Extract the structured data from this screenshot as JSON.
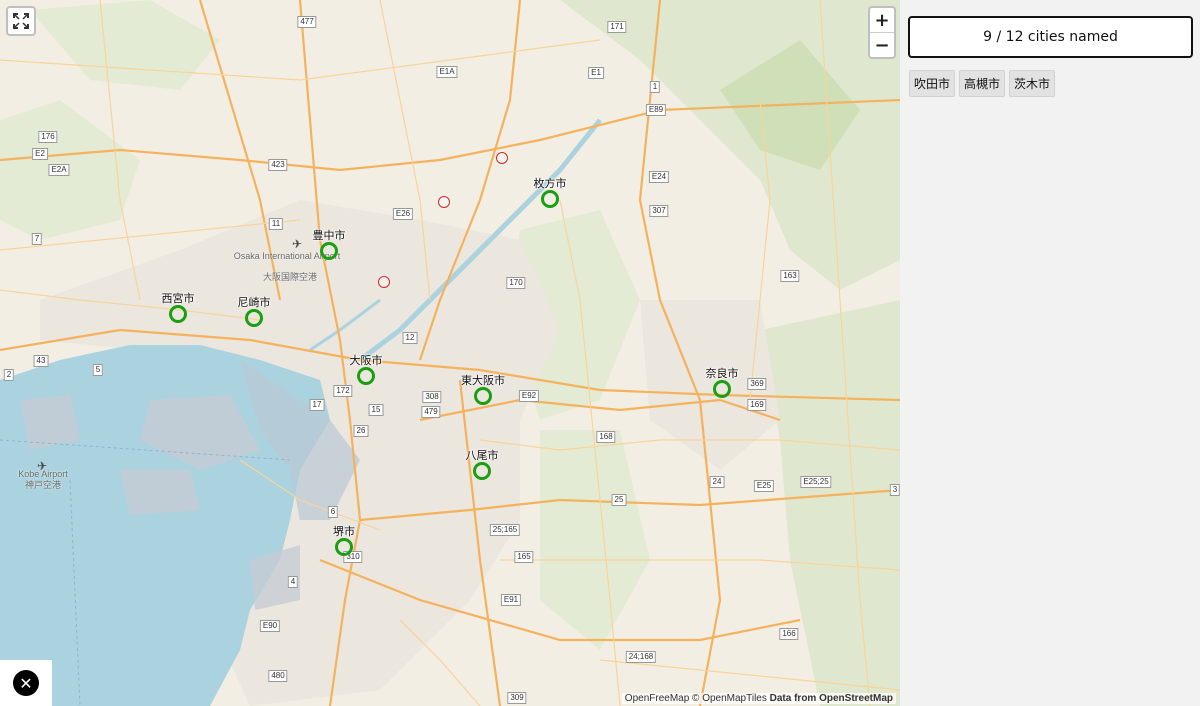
{
  "map": {
    "attribution_tiles": "OpenFreeMap © OpenMapTiles",
    "attribution_data": "Data from OpenStreetMap",
    "controls": {
      "zoom_in": "+",
      "zoom_out": "−",
      "fullscreen_icon": "fullscreen-icon",
      "close_icon": "close-icon"
    },
    "colors": {
      "water": "#aad3df",
      "land": "#f3eee4",
      "urban": "#e9e4dc",
      "motorway": "#f4b25c",
      "road": "#f8d49a",
      "forest": "#d9e6c6",
      "named_ring": "#1a9e12",
      "unnamed_ring": "#cc2a2a"
    },
    "named_cities": [
      {
        "name": "豊中市"
      },
      {
        "name": "枚方市"
      },
      {
        "name": "西宮市"
      },
      {
        "name": "尼崎市"
      },
      {
        "name": "大阪市"
      },
      {
        "name": "東大阪市"
      },
      {
        "name": "奈良市"
      },
      {
        "name": "八尾市"
      },
      {
        "name": "堺市"
      }
    ],
    "place_labels": [
      {
        "text": "Osaka International Airport"
      },
      {
        "text": "大阪国際空港"
      },
      {
        "text": "Kobe Airport"
      },
      {
        "text": "神戸空港"
      }
    ],
    "road_shields": [
      "477",
      "171",
      "E1A",
      "E1",
      "1",
      "E89",
      "176",
      "E2",
      "E2A",
      "423",
      "11",
      "E26",
      "307",
      "E24",
      "7",
      "163",
      "170",
      "43",
      "2",
      "5",
      "172",
      "17",
      "15",
      "308",
      "479",
      "E92",
      "26",
      "12",
      "369",
      "169",
      "168",
      "6",
      "25;165",
      "25",
      "24",
      "E25",
      "E25;25",
      "165",
      "E91",
      "166",
      "310",
      "E90",
      "480",
      "309",
      "24;168",
      "4",
      "3"
    ]
  },
  "panel": {
    "counter": "9 / 12 cities named",
    "named_tags": [
      "吹田市",
      "高槻市",
      "茨木市"
    ]
  }
}
